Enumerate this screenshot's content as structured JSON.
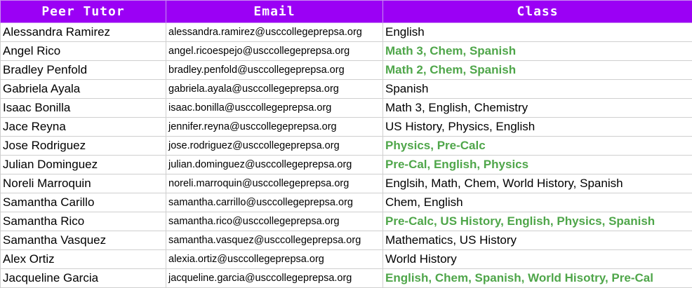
{
  "colors": {
    "header_bg": "#9b00f5",
    "header_text": "#ffffff",
    "highlight_text": "#4fa64a"
  },
  "columns": [
    "Peer Tutor",
    "Email",
    "Class"
  ],
  "rows": [
    {
      "name": "Alessandra Ramirez",
      "email": "alessandra.ramirez@usccollegeprepsa.org",
      "class": "English",
      "highlight": false
    },
    {
      "name": "Angel Rico",
      "email": "angel.ricoespejo@usccollegeprepsa.org",
      "class": "Math 3, Chem, Spanish",
      "highlight": true
    },
    {
      "name": "Bradley Penfold",
      "email": "bradley.penfold@usccollegeprepsa.org",
      "class": "Math 2, Chem, Spanish",
      "highlight": true
    },
    {
      "name": "Gabriela Ayala",
      "email": "gabriela.ayala@usccollegeprepsa.org",
      "class": "Spanish",
      "highlight": false
    },
    {
      "name": "Isaac Bonilla",
      "email": "isaac.bonilla@usccollegeprepsa.org",
      "class": "Math 3, English, Chemistry",
      "highlight": false
    },
    {
      "name": "Jace Reyna",
      "email": "jennifer.reyna@usccollegeprepsa.org",
      "class": "US History, Physics, English",
      "highlight": false
    },
    {
      "name": "Jose Rodriguez",
      "email": "jose.rodriguez@usccollegeprepsa.org",
      "class": "Physics, Pre-Calc",
      "highlight": true
    },
    {
      "name": "Julian Dominguez",
      "email": "julian.dominguez@usccollegeprepsa.org",
      "class": "Pre-Cal, English, Physics",
      "highlight": true
    },
    {
      "name": "Noreli Marroquin",
      "email": "noreli.marroquin@usccollegeprepsa.org",
      "class": "Englsih, Math, Chem, World History, Spanish",
      "highlight": false
    },
    {
      "name": "Samantha Carillo",
      "email": "samantha.carrillo@usccollegeprepsa.org",
      "class": "Chem, English",
      "highlight": false
    },
    {
      "name": "Samantha Rico",
      "email": "samantha.rico@usccollegeprepsa.org",
      "class": "Pre-Calc, US History, English, Physics, Spanish",
      "highlight": true
    },
    {
      "name": "Samantha Vasquez",
      "email": "samantha.vasquez@usccollegeprepsa.org",
      "class": "Mathematics, US History",
      "highlight": false
    },
    {
      "name": "Alex Ortiz",
      "email": "alexia.ortiz@usccollegeprepsa.org",
      "class": "World History",
      "highlight": false
    },
    {
      "name": "Jacqueline Garcia",
      "email": "jacqueline.garcia@usccollegeprepsa.org",
      "class": "English, Chem, Spanish, World Hisotry, Pre-Cal",
      "highlight": true
    }
  ]
}
